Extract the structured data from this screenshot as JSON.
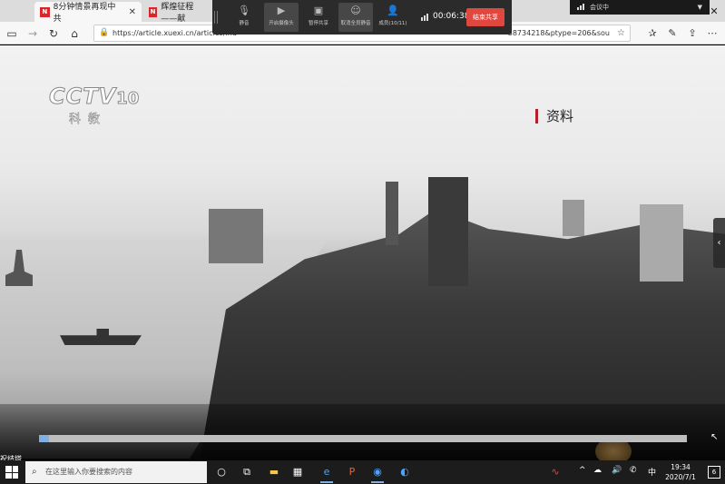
{
  "browser": {
    "tabs": [
      {
        "label": "8分钟情景再现中共",
        "favicon": "N"
      },
      {
        "label": "辉煌征程——献",
        "favicon": "N"
      }
    ],
    "url": "https://article.xuexi.cn/articles/ind",
    "url_tail": "38734218&ptype=206&sou"
  },
  "meeting": {
    "buttons": [
      {
        "label": "静音",
        "icon": "microphone-icon"
      },
      {
        "label": "开启摄像头",
        "icon": "camera-icon"
      },
      {
        "label": "暂停共享",
        "icon": "pause-share-icon"
      },
      {
        "label": "取消全员静音",
        "icon": "unmute-all-icon"
      },
      {
        "label": "成员(10/11)",
        "icon": "members-icon"
      }
    ],
    "timer": "00:06:38",
    "end_share_label": "结束共享",
    "status_label": "会议中"
  },
  "video": {
    "channel_logo": "CCTV",
    "channel_number": "10",
    "channel_name": "科教",
    "caption_tag": "资料",
    "progress": 0.015
  },
  "taskbar": {
    "search_placeholder": "在这里输入你要搜索的内容",
    "ime": "中",
    "time": "19:34",
    "date": "2020/7/1",
    "notification_count": "6"
  },
  "desktop": {
    "icon_label": "祝结塔"
  },
  "colors": {
    "end_button": "#e0473e",
    "favicon": "#d8262c",
    "caption_bar": "#b3202a"
  }
}
